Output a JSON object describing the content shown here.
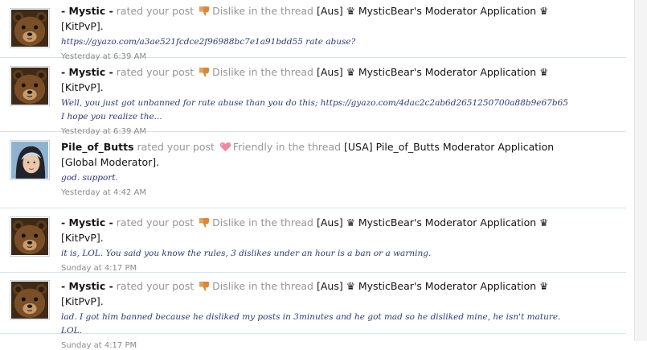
{
  "alerts": [
    {
      "user": "- Mystic -",
      "avatar": "bear-avatar",
      "rated_text": "rated your post",
      "rating": "Dislike",
      "rating_icon": "thumbs-down-icon",
      "in_thread_text": "in the thread",
      "thread": "[Aus] ♛ MysticBear's Moderator Application ♛ [KitPvP].",
      "snippet": "https://gyazo.com/a3ae521fcdce2f96988bc7e1a91bdd55 rate abuse?",
      "time": "Yesterday at 6:39 AM"
    },
    {
      "user": "- Mystic -",
      "avatar": "bear-avatar",
      "rated_text": "rated your post",
      "rating": "Dislike",
      "rating_icon": "thumbs-down-icon",
      "in_thread_text": "in the thread",
      "thread": "[Aus] ♛ MysticBear's Moderator Application ♛ [KitPvP].",
      "snippet": "Well, you just got unbanned for rate abuse than you do this; https://gyazo.com/4dac2c2ab6d2651250700a88b9e67b65 I hope you realize the...",
      "time": "Yesterday at 6:39 AM"
    },
    {
      "user": "Pile_of_Butts",
      "avatar": "user-photo-avatar",
      "rated_text": "rated your post",
      "rating": "Friendly",
      "rating_icon": "heart-icon",
      "in_thread_text": "in the thread",
      "thread": "[USA] Pile_of_Butts Moderator Application [Global Moderator].",
      "snippet": "god. support.",
      "time": "Yesterday at 4:42 AM"
    },
    {
      "user": "- Mystic -",
      "avatar": "bear-avatar",
      "rated_text": "rated your post",
      "rating": "Dislike",
      "rating_icon": "thumbs-down-icon",
      "in_thread_text": "in the thread",
      "thread": "[Aus] ♛ MysticBear's Moderator Application ♛ [KitPvP].",
      "snippet": "it is, LOL. You said you know the rules, 3 dislikes under an hour is a ban or a warning.",
      "time": "Sunday at 4:17 PM"
    },
    {
      "user": "- Mystic -",
      "avatar": "bear-avatar",
      "rated_text": "rated your post",
      "rating": "Dislike",
      "rating_icon": "thumbs-down-icon",
      "in_thread_text": "in the thread",
      "thread": "[Aus] ♛ MysticBear's Moderator Application ♛ [KitPvP].",
      "snippet": "lad. I got him banned because he disliked my posts in 3minutes and he got mad so he disliked mine, he isn't mature. LOL.",
      "time": "Sunday at 4:17 PM"
    }
  ]
}
